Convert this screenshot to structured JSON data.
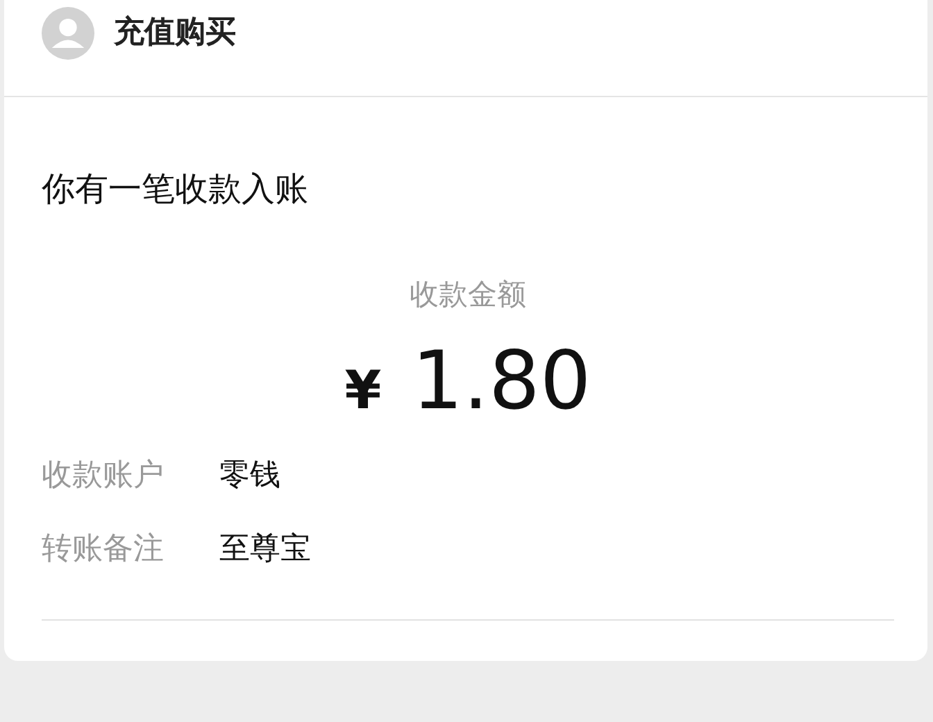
{
  "header": {
    "title": "充值购买"
  },
  "notice": {
    "title": "你有一笔收款入账",
    "amount_label": "收款金额",
    "currency": "¥",
    "amount": "1.80",
    "details": [
      {
        "label": "收款账户",
        "value": "零钱"
      },
      {
        "label": "转账备注",
        "value": "至尊宝"
      }
    ]
  }
}
